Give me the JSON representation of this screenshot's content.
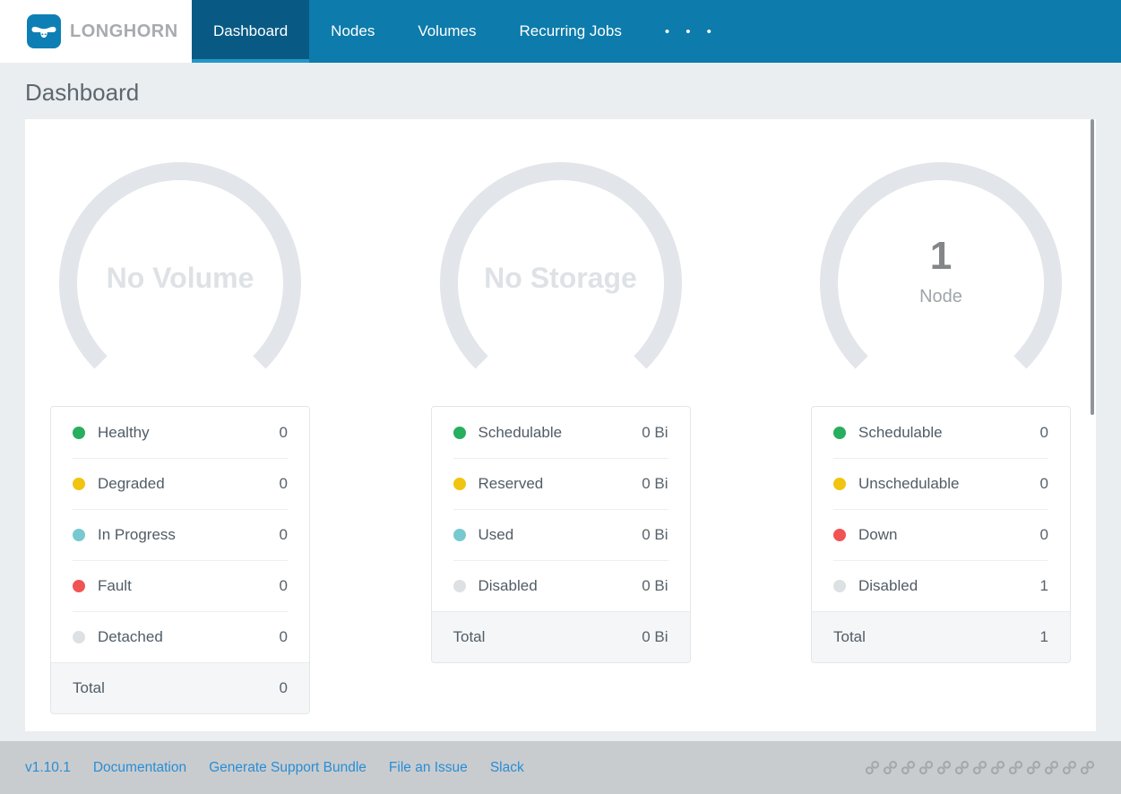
{
  "nav": {
    "brand": "LONGHORN",
    "items": [
      {
        "label": "Dashboard",
        "active": true
      },
      {
        "label": "Nodes",
        "active": false
      },
      {
        "label": "Volumes",
        "active": false
      },
      {
        "label": "Recurring Jobs",
        "active": false
      }
    ],
    "overflow_dots": "• • •"
  },
  "page": {
    "title": "Dashboard"
  },
  "gauges": [
    {
      "name": "volume",
      "center_text": "No Volume"
    },
    {
      "name": "storage",
      "center_text": "No Storage"
    },
    {
      "name": "node",
      "value": "1",
      "label": "Node"
    }
  ],
  "legends": [
    {
      "rows": [
        {
          "label": "Healthy",
          "value": "0",
          "color": "#27AE5F"
        },
        {
          "label": "Degraded",
          "value": "0",
          "color": "#F1C40F"
        },
        {
          "label": "In Progress",
          "value": "0",
          "color": "#78C9CF"
        },
        {
          "label": "Fault",
          "value": "0",
          "color": "#F15354"
        },
        {
          "label": "Detached",
          "value": "0",
          "color": "#DEE1E3"
        }
      ],
      "total": {
        "label": "Total",
        "value": "0"
      }
    },
    {
      "rows": [
        {
          "label": "Schedulable",
          "value": "0 Bi",
          "color": "#27AE5F"
        },
        {
          "label": "Reserved",
          "value": "0 Bi",
          "color": "#F1C40F"
        },
        {
          "label": "Used",
          "value": "0 Bi",
          "color": "#78C9CF"
        },
        {
          "label": "Disabled",
          "value": "0 Bi",
          "color": "#DEE1E3"
        }
      ],
      "total": {
        "label": "Total",
        "value": "0 Bi"
      }
    },
    {
      "rows": [
        {
          "label": "Schedulable",
          "value": "0",
          "color": "#27AE5F"
        },
        {
          "label": "Unschedulable",
          "value": "0",
          "color": "#F1C40F"
        },
        {
          "label": "Down",
          "value": "0",
          "color": "#F15354"
        },
        {
          "label": "Disabled",
          "value": "1",
          "color": "#DEE1E3"
        }
      ],
      "total": {
        "label": "Total",
        "value": "1"
      }
    }
  ],
  "footer": {
    "version": "v1.10.1",
    "links": [
      "Documentation",
      "Generate Support Bundle",
      "File an Issue",
      "Slack"
    ],
    "link_icon_count": 13
  },
  "colors": {
    "nav_bg": "#0D7BAB",
    "nav_active_bg": "#085A84",
    "nav_active_strip": "#2496C8",
    "gauge_arc": "#E2E5E9",
    "footer_bg": "#C9CCCF",
    "link_blue": "#2A8DD4"
  }
}
